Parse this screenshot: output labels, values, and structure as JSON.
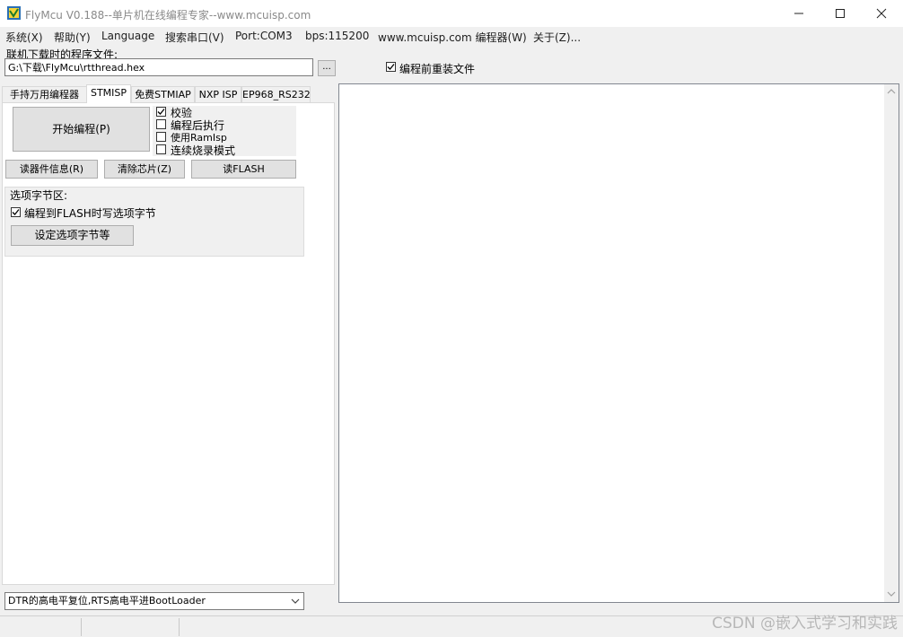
{
  "window": {
    "title": "FlyMcu V0.188--单片机在线编程专家--www.mcuisp.com",
    "icon": "flymcu-app-icon",
    "minimize_icon": "minimize-icon",
    "maximize_icon": "maximize-icon",
    "close_icon": "close-icon"
  },
  "menu": {
    "items": [
      {
        "label": "系统(X)"
      },
      {
        "label": "帮助(Y)"
      },
      {
        "label": "Language"
      },
      {
        "label": "搜索串口(V)"
      },
      {
        "label": "Port:COM3"
      },
      {
        "label": "bps:115200"
      },
      {
        "label": "www.mcuisp.com 编程器(W)"
      },
      {
        "label": "关于(Z)..."
      }
    ]
  },
  "file": {
    "label": "联机下载时的程序文件:",
    "path": "G:\\下载\\FlyMcu\\rtthread.hex",
    "browse_label": "...",
    "reload_checked": true,
    "reload_label": "编程前重装文件"
  },
  "tabs": [
    {
      "label": "手持万用编程器",
      "active": false
    },
    {
      "label": "STMISP",
      "active": true
    },
    {
      "label": "免费STMIAP",
      "active": false
    },
    {
      "label": "NXP ISP",
      "active": false
    },
    {
      "label": "EP968_RS232",
      "active": false
    }
  ],
  "stmisp": {
    "start_button": "开始编程(P)",
    "options": [
      {
        "label": "校验",
        "checked": true
      },
      {
        "label": "编程后执行",
        "checked": false
      },
      {
        "label": "使用RamIsp",
        "checked": false
      },
      {
        "label": "连续烧录模式",
        "checked": false
      }
    ],
    "read_info_button": "读器件信息(R)",
    "erase_button": "清除芯片(Z)",
    "read_flash_button": "读FLASH",
    "option_bytes": {
      "title": "选项字节区:",
      "write_checked": true,
      "write_label": "编程到FLASH时写选项字节",
      "set_button": "设定选项字节等"
    }
  },
  "reset_mode": {
    "selected": "DTR的高电平复位,RTS高电平进BootLoader"
  },
  "watermark": "CSDN @嵌入式学习和实践"
}
